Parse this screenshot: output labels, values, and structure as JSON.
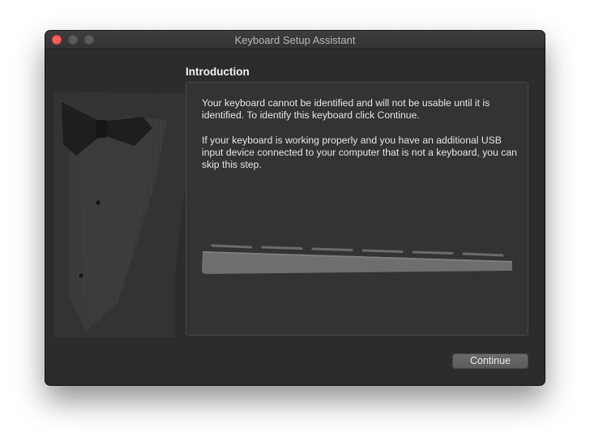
{
  "window": {
    "title": "Keyboard Setup Assistant"
  },
  "section": {
    "heading": "Introduction"
  },
  "body": {
    "paragraph_1": "Your keyboard cannot be identified and will not be usable until it is identified. To identify this keyboard click Continue.",
    "paragraph_2": "If your keyboard is working properly and you have an additional USB input device connected to your computer that is not a keyboard, you can skip this step."
  },
  "buttons": {
    "continue_label": "Continue"
  },
  "icons": {
    "tuxedo": "tuxedo-illustration-icon",
    "keyboard": "keyboard-illustration-icon"
  },
  "colors": {
    "window_bg": "#2c2c2e",
    "panel_bg": "#333335",
    "close_button": "#fe5f57"
  }
}
